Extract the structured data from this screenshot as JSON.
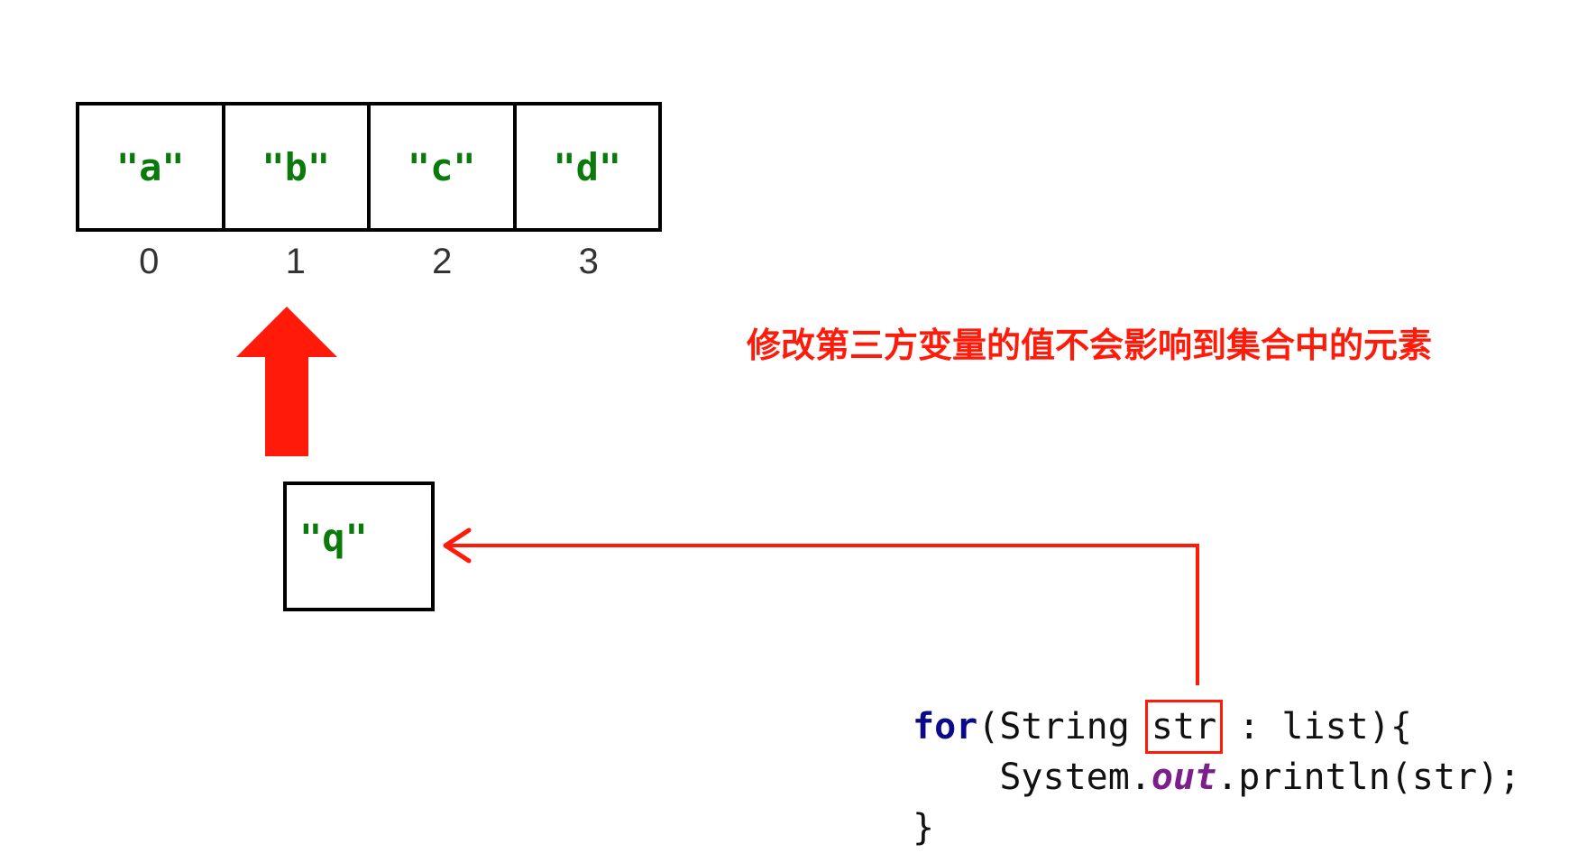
{
  "array": {
    "cells": [
      "\"a\"",
      "\"b\"",
      "\"c\"",
      "\"d\""
    ],
    "indices": [
      "0",
      "1",
      "2",
      "3"
    ]
  },
  "note": "修改第三方变量的值不会影响到集合中的元素",
  "variable_box": {
    "value": "\"q\""
  },
  "code": {
    "line1": {
      "keyword": "for",
      "open": "(String ",
      "var": "str",
      "rest": " : list){"
    },
    "line2": {
      "indent": "    ",
      "prefix": "System.",
      "field": "out",
      "suffix": ".println(str);"
    },
    "line3": "}"
  },
  "colors": {
    "accent_red": "#ff1a0a",
    "value_green": "#0a7a0a",
    "keyword_blue": "#0b0b8a",
    "field_purple": "#7a1f8c"
  }
}
